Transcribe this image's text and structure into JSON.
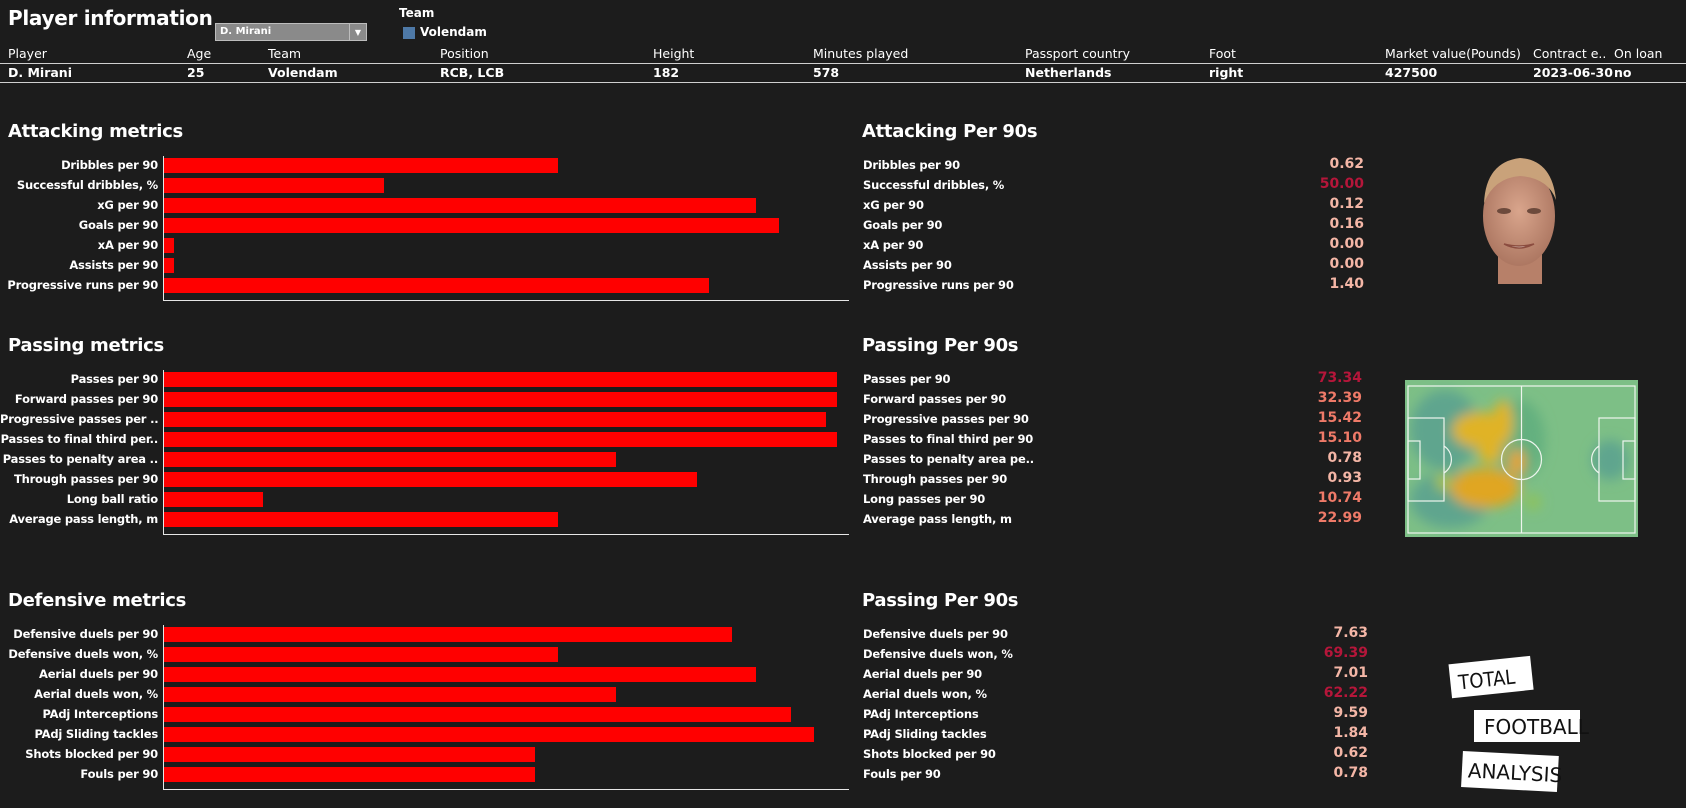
{
  "header": {
    "title": "Player information",
    "player_select": {
      "value": "D. Mirani"
    },
    "legend": {
      "title": "Team",
      "items": [
        {
          "label": "Volendam",
          "color": "#4e79a7"
        }
      ]
    }
  },
  "info_table": {
    "columns": [
      "Player",
      "Age",
      "Team",
      "Position",
      "Height",
      "Minutes played",
      "Passport country",
      "Foot",
      "Market value(Pounds)",
      "Contract e..",
      "On loan"
    ],
    "row": [
      "D. Mirani",
      "25",
      "Volendam",
      "RCB, LCB",
      "182",
      "578",
      "Netherlands",
      "right",
      "427500",
      "2023-06-30",
      "no"
    ]
  },
  "colors": {
    "bar": "#ff0000",
    "value_low": "#f4b6a6",
    "value_mid": "#ef7a68",
    "value_high": "#b5163a"
  },
  "sections": {
    "attacking": {
      "title": "Attacking metrics",
      "table_title": "Attacking Per 90s"
    },
    "passing": {
      "title": "Passing metrics",
      "table_title": "Passing Per 90s"
    },
    "defensive": {
      "title": "Defensive metrics",
      "table_title": "Passing Per 90s"
    }
  },
  "chart_data": [
    {
      "type": "bar",
      "orientation": "horizontal",
      "title": "Attacking metrics",
      "xlabel": "",
      "ylabel": "",
      "categories": [
        "Dribbles per 90",
        "Successful dribbles, %",
        "xG per 90",
        "Goals per 90",
        "xA per 90",
        "Assists per 90",
        "Progressive runs per 90"
      ],
      "values": [
        0.585,
        0.327,
        0.88,
        0.914,
        0.015,
        0.015,
        0.81
      ],
      "value_units": "relative bar length (fraction of axis max)",
      "xlim": [
        0,
        1
      ],
      "grid": false
    },
    {
      "type": "bar",
      "orientation": "horizontal",
      "title": "Passing metrics",
      "xlabel": "",
      "ylabel": "",
      "categories": [
        "Passes per 90",
        "Forward passes per 90",
        "Progressive passes per ..",
        "Passes to final third per..",
        "Passes to penalty area ..",
        "Through passes per 90",
        "Long ball ratio",
        "Average pass length, m"
      ],
      "values": [
        1.0,
        1.0,
        0.984,
        1.0,
        0.672,
        0.792,
        0.147,
        0.585
      ],
      "value_units": "relative bar length (fraction of axis max)",
      "xlim": [
        0,
        1
      ],
      "grid": false
    },
    {
      "type": "bar",
      "orientation": "horizontal",
      "title": "Defensive metrics",
      "xlabel": "",
      "ylabel": "",
      "categories": [
        "Defensive duels per 90",
        "Defensive duels won, %",
        "Aerial duels per 90",
        "Aerial duels won, %",
        "PAdj Interceptions",
        "PAdj Sliding tackles",
        "Shots blocked per 90",
        "Fouls per 90"
      ],
      "values": [
        0.844,
        0.585,
        0.88,
        0.672,
        0.932,
        0.966,
        0.551,
        0.551
      ],
      "value_units": "relative bar length (fraction of axis max)",
      "xlim": [
        0,
        1
      ],
      "grid": false
    },
    {
      "type": "table",
      "title": "Attacking Per 90s",
      "rows": [
        {
          "label": "Dribbles per 90",
          "value": "0.62",
          "tone": "low"
        },
        {
          "label": "Successful dribbles, %",
          "value": "50.00",
          "tone": "high"
        },
        {
          "label": "xG per 90",
          "value": "0.12",
          "tone": "low"
        },
        {
          "label": "Goals per 90",
          "value": "0.16",
          "tone": "low"
        },
        {
          "label": "xA per 90",
          "value": "0.00",
          "tone": "low"
        },
        {
          "label": "Assists per 90",
          "value": "0.00",
          "tone": "low"
        },
        {
          "label": "Progressive runs per 90",
          "value": "1.40",
          "tone": "low"
        }
      ]
    },
    {
      "type": "table",
      "title": "Passing Per 90s",
      "rows": [
        {
          "label": "Passes per 90",
          "value": "73.34",
          "tone": "high"
        },
        {
          "label": "Forward passes per 90",
          "value": "32.39",
          "tone": "mid"
        },
        {
          "label": "Progressive passes per 90",
          "value": "15.42",
          "tone": "mid"
        },
        {
          "label": "Passes to final third per 90",
          "value": "15.10",
          "tone": "mid"
        },
        {
          "label": "Passes to penalty area pe..",
          "value": "0.78",
          "tone": "low"
        },
        {
          "label": "Through passes per 90",
          "value": "0.93",
          "tone": "low"
        },
        {
          "label": "Long passes per 90",
          "value": "10.74",
          "tone": "mid"
        },
        {
          "label": "Average pass length, m",
          "value": "22.99",
          "tone": "mid"
        }
      ]
    },
    {
      "type": "table",
      "title": "Passing Per 90s",
      "rows": [
        {
          "label": "Defensive duels per 90",
          "value": "7.63",
          "tone": "low"
        },
        {
          "label": "Defensive duels won, %",
          "value": "69.39",
          "tone": "high"
        },
        {
          "label": "Aerial duels per 90",
          "value": "7.01",
          "tone": "low"
        },
        {
          "label": "Aerial duels won, %",
          "value": "62.22",
          "tone": "high"
        },
        {
          "label": "PAdj Interceptions",
          "value": "9.59",
          "tone": "low"
        },
        {
          "label": "PAdj Sliding tackles",
          "value": "1.84",
          "tone": "low"
        },
        {
          "label": "Shots blocked per 90",
          "value": "0.62",
          "tone": "low"
        },
        {
          "label": "Fouls per 90",
          "value": "0.78",
          "tone": "low"
        }
      ]
    }
  ],
  "images": {
    "photo": "player-photo",
    "heatmap": "pitch-heatmap",
    "logo": {
      "name": "total-football-analysis-logo",
      "lines": [
        "TOTAL",
        "FOOTBALL",
        "ANALYSIS"
      ]
    }
  }
}
